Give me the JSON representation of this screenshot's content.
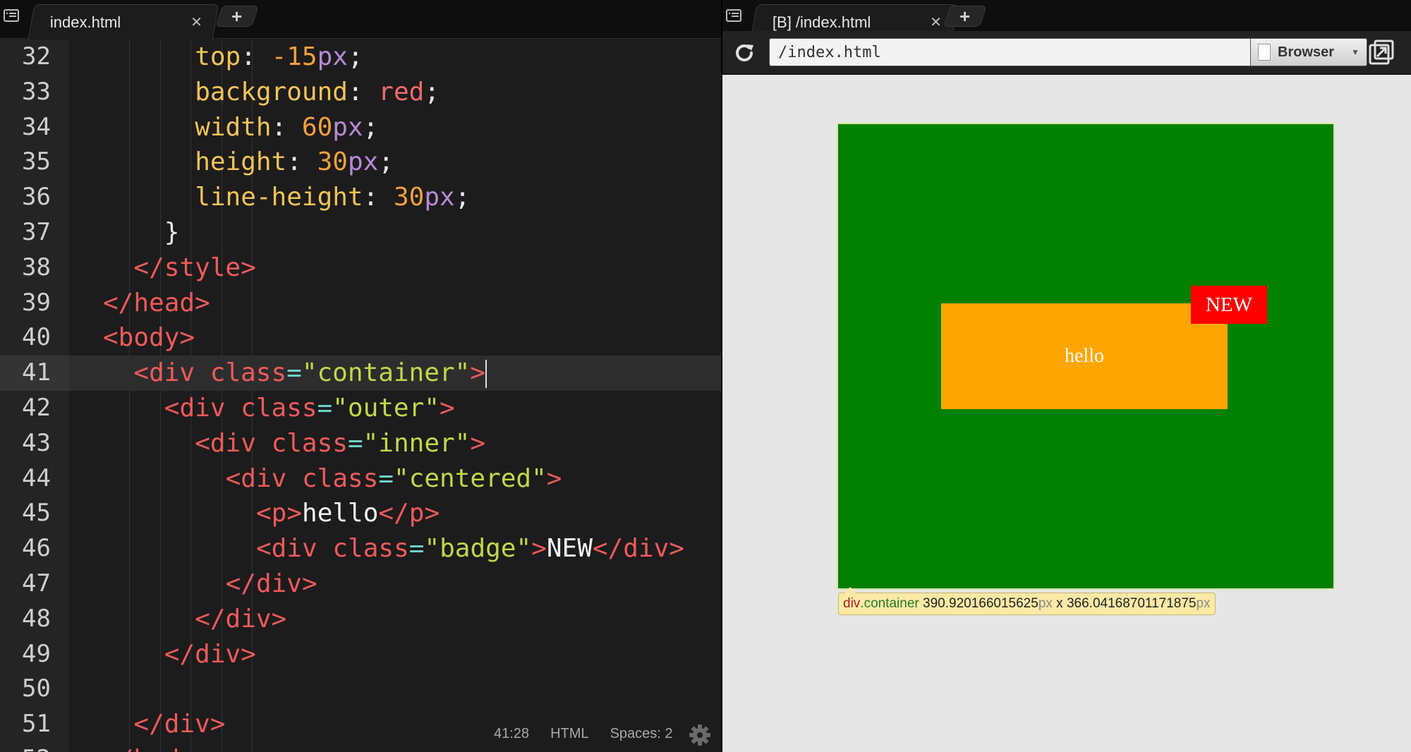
{
  "editor": {
    "tab_label": "index.html",
    "new_tab_label": "+",
    "first_line": 32,
    "active_line": 41,
    "lines": [
      [
        {
          "t": "top",
          "c": "prop",
          "i": 3
        },
        {
          "t": ": ",
          "c": "pun"
        },
        {
          "t": "-15",
          "c": "num"
        },
        {
          "t": "px",
          "c": "unit"
        },
        {
          "t": ";",
          "c": "pun"
        }
      ],
      [
        {
          "t": "background",
          "c": "prop",
          "i": 3
        },
        {
          "t": ": ",
          "c": "pun"
        },
        {
          "t": "red",
          "c": "val"
        },
        {
          "t": ";",
          "c": "pun"
        }
      ],
      [
        {
          "t": "width",
          "c": "prop",
          "i": 3
        },
        {
          "t": ": ",
          "c": "pun"
        },
        {
          "t": "60",
          "c": "num"
        },
        {
          "t": "px",
          "c": "unit"
        },
        {
          "t": ";",
          "c": "pun"
        }
      ],
      [
        {
          "t": "height",
          "c": "prop",
          "i": 3
        },
        {
          "t": ": ",
          "c": "pun"
        },
        {
          "t": "30",
          "c": "num"
        },
        {
          "t": "px",
          "c": "unit"
        },
        {
          "t": ";",
          "c": "pun"
        }
      ],
      [
        {
          "t": "line-height",
          "c": "prop",
          "i": 3
        },
        {
          "t": ": ",
          "c": "pun"
        },
        {
          "t": "30",
          "c": "num"
        },
        {
          "t": "px",
          "c": "unit"
        },
        {
          "t": ";",
          "c": "pun"
        }
      ],
      [
        {
          "t": "}",
          "c": "pun",
          "i": 2
        }
      ],
      [
        {
          "t": "</style>",
          "c": "tag",
          "i": 1
        }
      ],
      [
        {
          "t": "</head>",
          "c": "tag",
          "i": 0
        }
      ],
      [
        {
          "t": "<body>",
          "c": "tag",
          "i": 0
        }
      ],
      [
        {
          "t": "<div ",
          "c": "tag",
          "i": 1
        },
        {
          "t": "class",
          "c": "attr"
        },
        {
          "t": "=",
          "c": "eq"
        },
        {
          "t": "\"container\"",
          "c": "str"
        },
        {
          "t": ">",
          "c": "tag"
        }
      ],
      [
        {
          "t": "<div ",
          "c": "tag",
          "i": 2
        },
        {
          "t": "class",
          "c": "attr"
        },
        {
          "t": "=",
          "c": "eq"
        },
        {
          "t": "\"outer\"",
          "c": "str"
        },
        {
          "t": ">",
          "c": "tag"
        }
      ],
      [
        {
          "t": "<div ",
          "c": "tag",
          "i": 3
        },
        {
          "t": "class",
          "c": "attr"
        },
        {
          "t": "=",
          "c": "eq"
        },
        {
          "t": "\"inner\"",
          "c": "str"
        },
        {
          "t": ">",
          "c": "tag"
        }
      ],
      [
        {
          "t": "<div ",
          "c": "tag",
          "i": 4
        },
        {
          "t": "class",
          "c": "attr"
        },
        {
          "t": "=",
          "c": "eq"
        },
        {
          "t": "\"centered\"",
          "c": "str"
        },
        {
          "t": ">",
          "c": "tag"
        }
      ],
      [
        {
          "t": "<p>",
          "c": "tag",
          "i": 5
        },
        {
          "t": "hello",
          "c": "txt"
        },
        {
          "t": "</p>",
          "c": "tag"
        }
      ],
      [
        {
          "t": "<div ",
          "c": "tag",
          "i": 5
        },
        {
          "t": "class",
          "c": "attr"
        },
        {
          "t": "=",
          "c": "eq"
        },
        {
          "t": "\"badge\"",
          "c": "str"
        },
        {
          "t": ">",
          "c": "tag"
        },
        {
          "t": "NEW",
          "c": "txt"
        },
        {
          "t": "</div>",
          "c": "tag"
        }
      ],
      [
        {
          "t": "</div>",
          "c": "tag",
          "i": 4
        }
      ],
      [
        {
          "t": "</div>",
          "c": "tag",
          "i": 3
        }
      ],
      [
        {
          "t": "</div>",
          "c": "tag",
          "i": 2
        }
      ],
      [],
      [
        {
          "t": "</div>",
          "c": "tag",
          "i": 1
        }
      ],
      [
        {
          "t": "</body>",
          "c": "tag",
          "i": 0
        }
      ]
    ],
    "status": {
      "cursor_pos": "41:28",
      "language": "HTML",
      "indent": "Spaces: 2"
    }
  },
  "browser": {
    "tab_label": "[B] /index.html",
    "new_tab_label": "+",
    "url_value": "/index.html",
    "preview_mode": "Browser",
    "page": {
      "paragraph": "hello",
      "badge": "NEW"
    },
    "inspector": {
      "tag": "div",
      "class_name": ".container",
      "width": "390.920166015625",
      "height": "366.04168701171875",
      "unit": "px",
      "separator": " x "
    }
  },
  "colors": {
    "container": "#008000",
    "orange_box": "#ffa500",
    "badge": "#ff0000",
    "tooltip": "#fbe9a6"
  }
}
